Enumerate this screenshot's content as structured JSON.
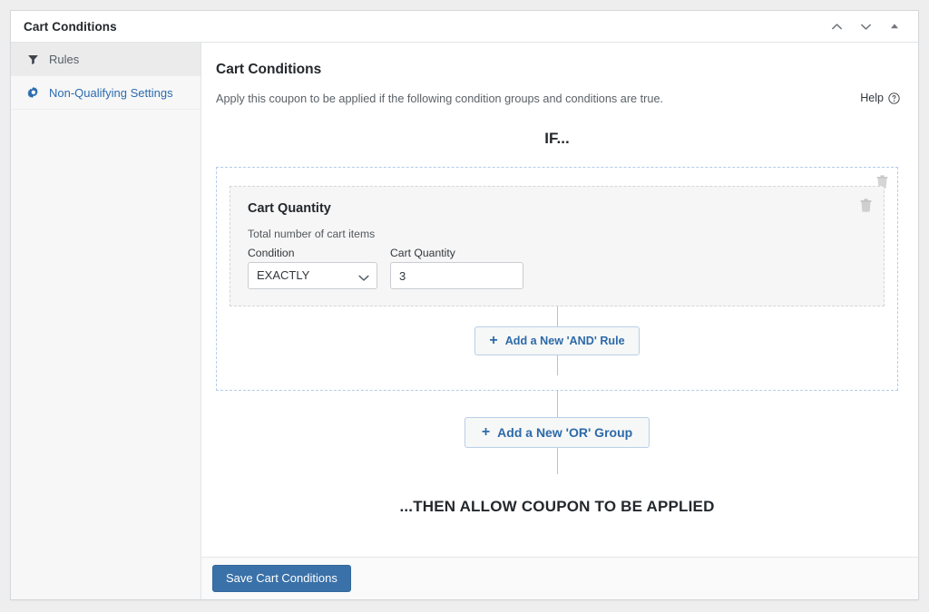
{
  "window": {
    "title": "Cart Conditions",
    "header_actions": [
      {
        "name": "move-up-icon",
        "label": "Move up"
      },
      {
        "name": "move-down-icon",
        "label": "Move down"
      },
      {
        "name": "toggle-panel-icon",
        "label": "Toggle panel"
      }
    ]
  },
  "sidebar": {
    "items": [
      {
        "label": "Rules",
        "icon": "filter-icon",
        "active": true
      },
      {
        "label": "Non-Qualifying Settings",
        "icon": "gear-icon",
        "active": false
      }
    ]
  },
  "main": {
    "title": "Cart Conditions",
    "description": "Apply this coupon to be applied if the following condition groups and conditions are true.",
    "help_label": "Help",
    "help_icon": "question-circle-icon",
    "if_heading": "IF...",
    "then_heading": "...THEN ALLOW COUPON TO BE APPLIED",
    "group": {
      "delete_icon": "trash-icon",
      "rule": {
        "title": "Cart Quantity",
        "subtitle": "Total number of cart items",
        "delete_icon": "trash-icon",
        "condition_label": "Condition",
        "condition_value": "EXACTLY",
        "condition_options": [
          "EXACTLY"
        ],
        "quantity_label": "Cart Quantity",
        "quantity_value": "3"
      },
      "add_and_label": "Add a New 'AND' Rule",
      "add_and_icon": "plus-icon"
    },
    "add_or_label": "Add a New 'OR' Group",
    "add_or_icon": "plus-icon"
  },
  "footer": {
    "save_label": "Save Cart Conditions"
  },
  "colors": {
    "accent_blue": "#2c6aa8",
    "save_button": "#3a71a8",
    "group_border": "#b3ccea",
    "connector": "#a9c4e4",
    "sidebar_bg": "#f7f7f7",
    "rule_card_bg": "#f6f6f6"
  }
}
